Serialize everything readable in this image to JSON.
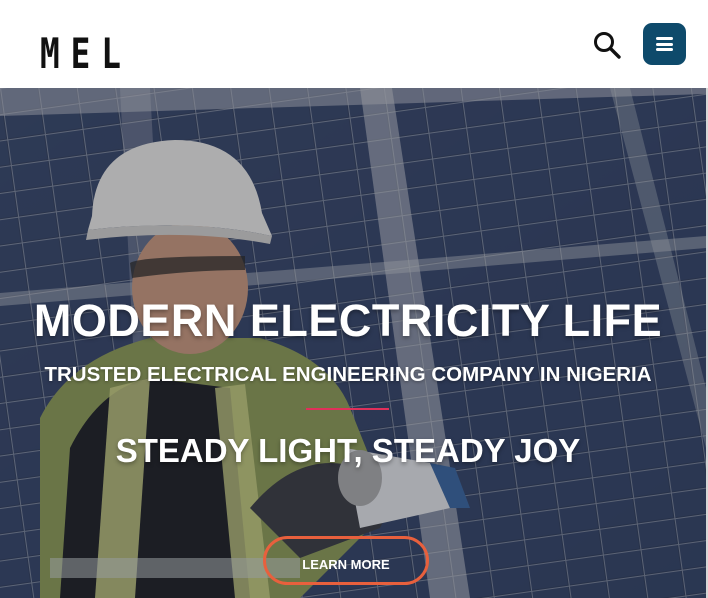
{
  "header": {
    "logo_text": "MEL",
    "search_icon": "search-icon",
    "menu_icon": "hamburger-menu-icon"
  },
  "hero": {
    "headline": "MODERN ELECTRICITY LIFE",
    "subheadline": "TRUSTED ELECTRICAL ENGINEERING COMPANY IN NIGERIA",
    "tagline": "STEADY LIGHT, STEADY JOY",
    "cta_label": "LEARN MORE"
  },
  "colors": {
    "menu_button_bg": "#0e4a6b",
    "divider": "#e0305a",
    "cta_border": "#e8603d",
    "text": "#ffffff"
  }
}
